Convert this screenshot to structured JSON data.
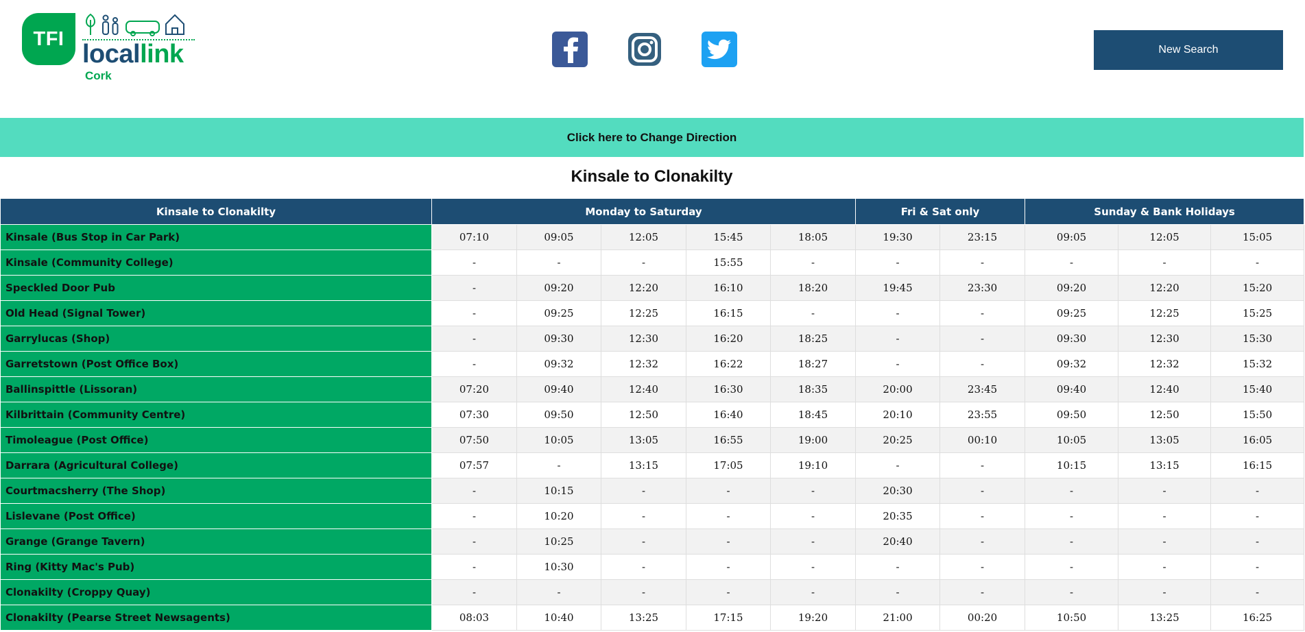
{
  "header": {
    "logo": {
      "badge": "TFI",
      "local": "local",
      "link": "link",
      "sub": "Cork"
    },
    "social": [
      "facebook-icon",
      "instagram-icon",
      "twitter-icon"
    ],
    "new_search_label": "New Search"
  },
  "change_direction_label": "Click here to Change Direction",
  "route_title": "Kinsale to Clonakilty",
  "table": {
    "header": {
      "route": "Kinsale to Clonakilty",
      "groups": [
        "Monday to Saturday",
        "Fri & Sat only",
        "Sunday & Bank Holidays"
      ]
    },
    "rows": [
      {
        "stop": "Kinsale (Bus Stop in Car Park)",
        "times": [
          "07:10",
          "09:05",
          "12:05",
          "15:45",
          "18:05",
          "19:30",
          "23:15",
          "09:05",
          "12:05",
          "15:05"
        ]
      },
      {
        "stop": "Kinsale (Community College)",
        "times": [
          "-",
          "-",
          "-",
          "15:55",
          "-",
          "-",
          "-",
          "-",
          "-",
          "-"
        ]
      },
      {
        "stop": "Speckled Door Pub",
        "times": [
          "-",
          "09:20",
          "12:20",
          "16:10",
          "18:20",
          "19:45",
          "23:30",
          "09:20",
          "12:20",
          "15:20"
        ]
      },
      {
        "stop": "Old Head (Signal Tower)",
        "times": [
          "-",
          "09:25",
          "12:25",
          "16:15",
          "-",
          "-",
          "-",
          "09:25",
          "12:25",
          "15:25"
        ]
      },
      {
        "stop": "Garrylucas (Shop)",
        "times": [
          "-",
          "09:30",
          "12:30",
          "16:20",
          "18:25",
          "-",
          "-",
          "09:30",
          "12:30",
          "15:30"
        ]
      },
      {
        "stop": "Garretstown (Post Office Box)",
        "times": [
          "-",
          "09:32",
          "12:32",
          "16:22",
          "18:27",
          "-",
          "-",
          "09:32",
          "12:32",
          "15:32"
        ]
      },
      {
        "stop": "Ballinspittle (Lissoran)",
        "times": [
          "07:20",
          "09:40",
          "12:40",
          "16:30",
          "18:35",
          "20:00",
          "23:45",
          "09:40",
          "12:40",
          "15:40"
        ]
      },
      {
        "stop": "Kilbrittain (Community Centre)",
        "times": [
          "07:30",
          "09:50",
          "12:50",
          "16:40",
          "18:45",
          "20:10",
          "23:55",
          "09:50",
          "12:50",
          "15:50"
        ]
      },
      {
        "stop": "Timoleague (Post Office)",
        "times": [
          "07:50",
          "10:05",
          "13:05",
          "16:55",
          "19:00",
          "20:25",
          "00:10",
          "10:05",
          "13:05",
          "16:05"
        ]
      },
      {
        "stop": "Darrara (Agricultural College)",
        "times": [
          "07:57",
          "-",
          "13:15",
          "17:05",
          "19:10",
          "-",
          "-",
          "10:15",
          "13:15",
          "16:15"
        ]
      },
      {
        "stop": "Courtmacsherry (The Shop)",
        "times": [
          "-",
          "10:15",
          "-",
          "-",
          "-",
          "20:30",
          "-",
          "-",
          "-",
          "-"
        ]
      },
      {
        "stop": "Lislevane (Post Office)",
        "times": [
          "-",
          "10:20",
          "-",
          "-",
          "-",
          "20:35",
          "-",
          "-",
          "-",
          "-"
        ]
      },
      {
        "stop": "Grange (Grange Tavern)",
        "times": [
          "-",
          "10:25",
          "-",
          "-",
          "-",
          "20:40",
          "-",
          "-",
          "-",
          "-"
        ]
      },
      {
        "stop": "Ring (Kitty Mac's Pub)",
        "times": [
          "-",
          "10:30",
          "-",
          "-",
          "-",
          "-",
          "-",
          "-",
          "-",
          "-"
        ]
      },
      {
        "stop": "Clonakilty (Croppy Quay)",
        "times": [
          "-",
          "-",
          "-",
          "-",
          "-",
          "-",
          "-",
          "-",
          "-",
          "-"
        ]
      },
      {
        "stop": "Clonakilty (Pearse Street Newsagents)",
        "times": [
          "08:03",
          "10:40",
          "13:25",
          "17:15",
          "19:20",
          "21:00",
          "00:20",
          "10:50",
          "13:25",
          "16:25"
        ]
      }
    ]
  }
}
